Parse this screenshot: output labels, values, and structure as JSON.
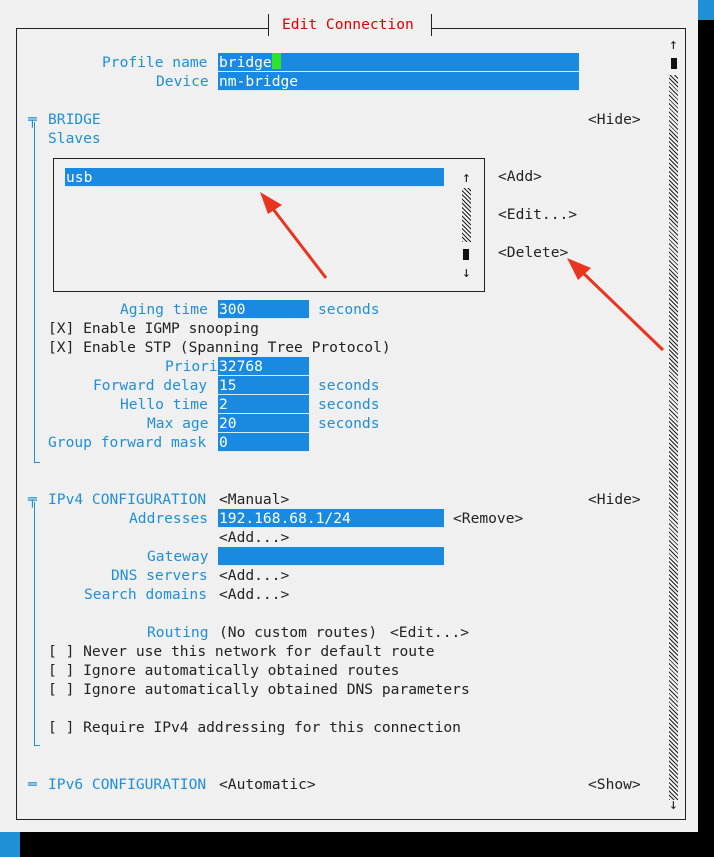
{
  "dialog": {
    "title": "Edit Connection"
  },
  "profile": {
    "name_label": "Profile name",
    "name_value": "bridge",
    "device_label": "Device",
    "device_value": "nm-bridge"
  },
  "bridge": {
    "header": "BRIDGE",
    "hide_label": "<Hide>",
    "slaves_label": "Slaves",
    "slaves": [
      "usb"
    ],
    "add_label": "<Add>",
    "edit_label": "<Edit...>",
    "delete_label": "<Delete>",
    "aging_label": "Aging time",
    "aging_value": "300",
    "aging_unit": "seconds",
    "igmp_label": "[X] Enable IGMP snooping",
    "stp_label": "[X] Enable STP (Spanning Tree Protocol)",
    "priority_label": "Priority",
    "priority_value": "32768",
    "forward_delay_label": "Forward delay",
    "forward_delay_value": "15",
    "forward_delay_unit": "seconds",
    "hello_label": "Hello time",
    "hello_value": "2",
    "hello_unit": "seconds",
    "max_age_label": "Max age",
    "max_age_value": "20",
    "max_age_unit": "seconds",
    "group_mask_label": "Group forward mask",
    "group_mask_value": "0"
  },
  "ipv4": {
    "header": "IPv4 CONFIGURATION",
    "mode": "<Manual>",
    "hide_label": "<Hide>",
    "addresses_label": "Addresses",
    "address_value": "192.168.68.1/24",
    "remove_label": "<Remove>",
    "add_label": "<Add...>",
    "gateway_label": "Gateway",
    "gateway_value": "",
    "dns_label": "DNS servers",
    "dns_add": "<Add...>",
    "search_label": "Search domains",
    "search_add": "<Add...>",
    "routing_label": "Routing",
    "routing_value": "(No custom routes)",
    "routing_edit": "<Edit...>",
    "never_default": "[ ] Never use this network for default route",
    "ignore_routes": "[ ] Ignore automatically obtained routes",
    "ignore_dns": "[ ] Ignore automatically obtained DNS parameters",
    "require_ipv4": "[ ] Require IPv4 addressing for this connection"
  },
  "ipv6": {
    "header": "IPv6 CONFIGURATION",
    "mode": "<Automatic>",
    "show_label": "<Show>"
  },
  "glyphs": {
    "up": "↑",
    "down": "↓",
    "collapse": "╤",
    "expand": "═"
  },
  "colors": {
    "accent": "#1f8fd6",
    "field": "#1a8ae0",
    "title": "#d00000",
    "annotation": "#e8351f"
  }
}
